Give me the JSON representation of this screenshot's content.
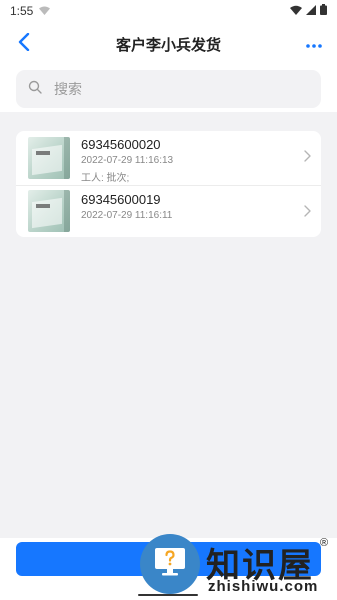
{
  "status_bar": {
    "time": "1:55"
  },
  "nav": {
    "title": "客户李小兵发货"
  },
  "search": {
    "placeholder": "搜索"
  },
  "items": [
    {
      "code": "69345600020",
      "time": "2022-07-29 11:16:13",
      "worker": "工人: 批次;"
    },
    {
      "code": "69345600019",
      "time": "2022-07-29 11:16:11"
    }
  ],
  "bottom": {
    "ship_label": ""
  },
  "watermark": {
    "text": "知识屋",
    "reg": "®",
    "sub": "zhishiwu.com"
  },
  "colors": {
    "accent": "#1677ff",
    "background": "#f2f2f4"
  }
}
